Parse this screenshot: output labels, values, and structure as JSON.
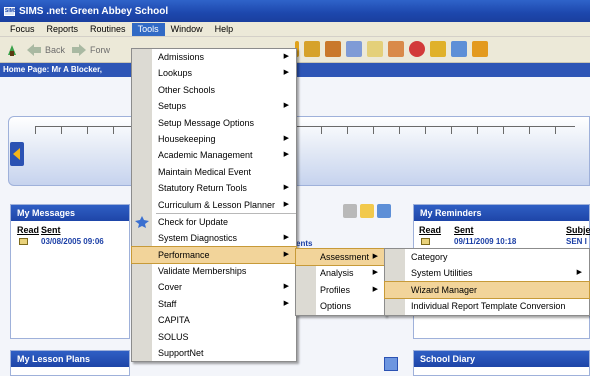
{
  "window": {
    "title": "SIMS .net: Green Abbey School",
    "app_icon": "SIMS"
  },
  "menubar": [
    "Focus",
    "Reports",
    "Routines",
    "Tools",
    "Window",
    "Help"
  ],
  "toolbar": {
    "back_label": "Back",
    "forward_label": "Forw"
  },
  "home_bar": "Home Page: Mr A Blocker, ",
  "messages": {
    "title": "My Messages",
    "col_read": "Read",
    "col_sent": "Sent",
    "row_sent": "03/08/2005 09:06"
  },
  "reminders": {
    "title": "My Reminders",
    "col_read": "Read",
    "col_sent": "Sent",
    "col_subject": "Subje",
    "row_sent": "09/11/2009 10:18",
    "row_subject": "SEN I"
  },
  "lesson_plans": {
    "title": "My Lesson Plans"
  },
  "school_diary": {
    "title": "School Diary"
  },
  "center_text": "ents",
  "tools_menu": [
    {
      "label": "Admissions",
      "submenu": true
    },
    {
      "label": "Lookups",
      "submenu": true
    },
    {
      "label": "Other Schools",
      "submenu": false
    },
    {
      "label": "Setups",
      "submenu": true
    },
    {
      "label": "Setup Message Options",
      "submenu": false
    },
    {
      "label": "Housekeeping",
      "submenu": true
    },
    {
      "label": "Academic Management",
      "submenu": true
    },
    {
      "label": "Maintain Medical Event",
      "submenu": false
    },
    {
      "label": "Statutory Return Tools",
      "submenu": true
    },
    {
      "label": "Curriculum & Lesson Planner",
      "submenu": true
    },
    {
      "label": "Check for Update",
      "submenu": false
    },
    {
      "label": "System Diagnostics",
      "submenu": true
    },
    {
      "label": "Performance",
      "submenu": true,
      "highlighted": true
    },
    {
      "label": "Validate Memberships",
      "submenu": false
    },
    {
      "label": "Cover",
      "submenu": true
    },
    {
      "label": "Staff",
      "submenu": true
    },
    {
      "label": "CAPITA",
      "submenu": false
    },
    {
      "label": "SOLUS",
      "submenu": false
    },
    {
      "label": "SupportNet",
      "submenu": false
    }
  ],
  "performance_menu": [
    {
      "label": "Assessment",
      "submenu": true,
      "highlighted": true
    },
    {
      "label": "Analysis",
      "submenu": true
    },
    {
      "label": "Profiles",
      "submenu": true
    },
    {
      "label": "Options",
      "submenu": false
    }
  ],
  "assessment_menu": [
    {
      "label": "Category",
      "submenu": false
    },
    {
      "label": "System Utilities",
      "submenu": true
    },
    {
      "label": "Wizard Manager",
      "submenu": false,
      "highlighted": true
    },
    {
      "label": "Individual Report Template Conversion",
      "submenu": false
    }
  ],
  "colors": {
    "title_bar": "#1d47ad",
    "menu_highlight": "#f2d49a",
    "panel_header": "#2f5fc4"
  }
}
